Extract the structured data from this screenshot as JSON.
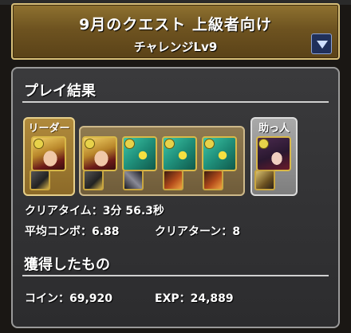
{
  "quest": {
    "title": "9月のクエスト 上級者向け",
    "subtitle": "チャレンジLv9"
  },
  "result": {
    "heading": "プレイ結果",
    "leader_label": "リーダー",
    "helper_label": "助っ人",
    "stats": {
      "clear_time_label": "クリアタイム：",
      "clear_time_value": "3分 56.3秒",
      "avg_combo_label": "平均コンボ：",
      "avg_combo_value": "6.88",
      "clear_turns_label": "クリアターン：",
      "clear_turns_value": "8"
    }
  },
  "rewards": {
    "heading": "獲得したもの",
    "coin_label": "コイン：",
    "coin_value": "69,920",
    "exp_label": "EXP：",
    "exp_value": "24,889"
  },
  "team": {
    "leader": "blonde-knight",
    "subs": [
      "blonde-knight",
      "green-dragon",
      "green-dragon",
      "green-dragon"
    ],
    "helper": "dark-hair-warrior",
    "assists": [
      "dark-armor",
      "dark-armor",
      "gold-blade",
      "fire-beast",
      "fire-beast",
      "gold-blade"
    ]
  },
  "colors": {
    "banner": "#7a5e28",
    "panel": "#333335",
    "leader_frame": "#a0803a",
    "helper_frame": "#9a9a9a"
  },
  "icons": [
    "dropdown-triangle-icon"
  ]
}
